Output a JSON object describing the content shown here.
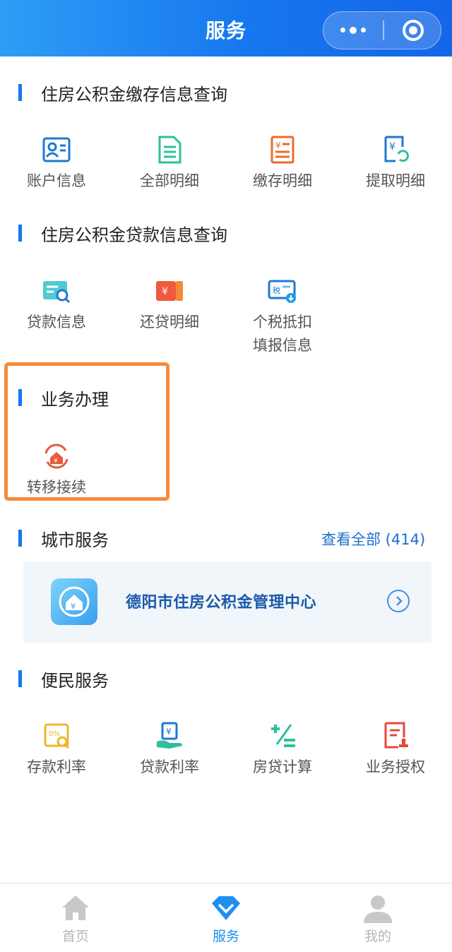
{
  "header": {
    "title": "服务"
  },
  "colors": {
    "primary": "#1677ee",
    "highlight_border": "#f58b3a",
    "card_bg": "#f1f6fb"
  },
  "sections": {
    "deposit": {
      "title": "住房公积金缴存信息查询",
      "items": [
        {
          "label": "账户信息",
          "icon": "account-card-icon"
        },
        {
          "label": "全部明细",
          "icon": "document-icon"
        },
        {
          "label": "缴存明细",
          "icon": "deposit-ledger-icon"
        },
        {
          "label": "提取明细",
          "icon": "withdraw-icon"
        }
      ]
    },
    "loan": {
      "title": "住房公积金贷款信息查询",
      "items": [
        {
          "label": "贷款信息",
          "icon": "loan-search-icon"
        },
        {
          "label": "还贷明细",
          "icon": "repayment-icon"
        },
        {
          "label": "个税抵扣\n填报信息",
          "icon": "tax-icon"
        }
      ]
    },
    "business": {
      "title": "业务办理",
      "items": [
        {
          "label": "转移接续",
          "icon": "transfer-icon"
        }
      ]
    },
    "city": {
      "title": "城市服务",
      "view_all": "查看全部 (414)",
      "card_name": "德阳市住房公积金管理中心"
    },
    "convenience": {
      "title": "便民服务",
      "items": [
        {
          "label": "存款利率",
          "icon": "deposit-rate-icon"
        },
        {
          "label": "贷款利率",
          "icon": "loan-rate-icon"
        },
        {
          "label": "房贷计算",
          "icon": "calculator-icon"
        },
        {
          "label": "业务授权",
          "icon": "authorization-icon"
        }
      ]
    }
  },
  "tabbar": {
    "active": "服务",
    "tabs": [
      {
        "label": "首页",
        "icon": "home-icon"
      },
      {
        "label": "服务",
        "icon": "service-diamond-icon"
      },
      {
        "label": "我的",
        "icon": "user-icon"
      }
    ]
  }
}
